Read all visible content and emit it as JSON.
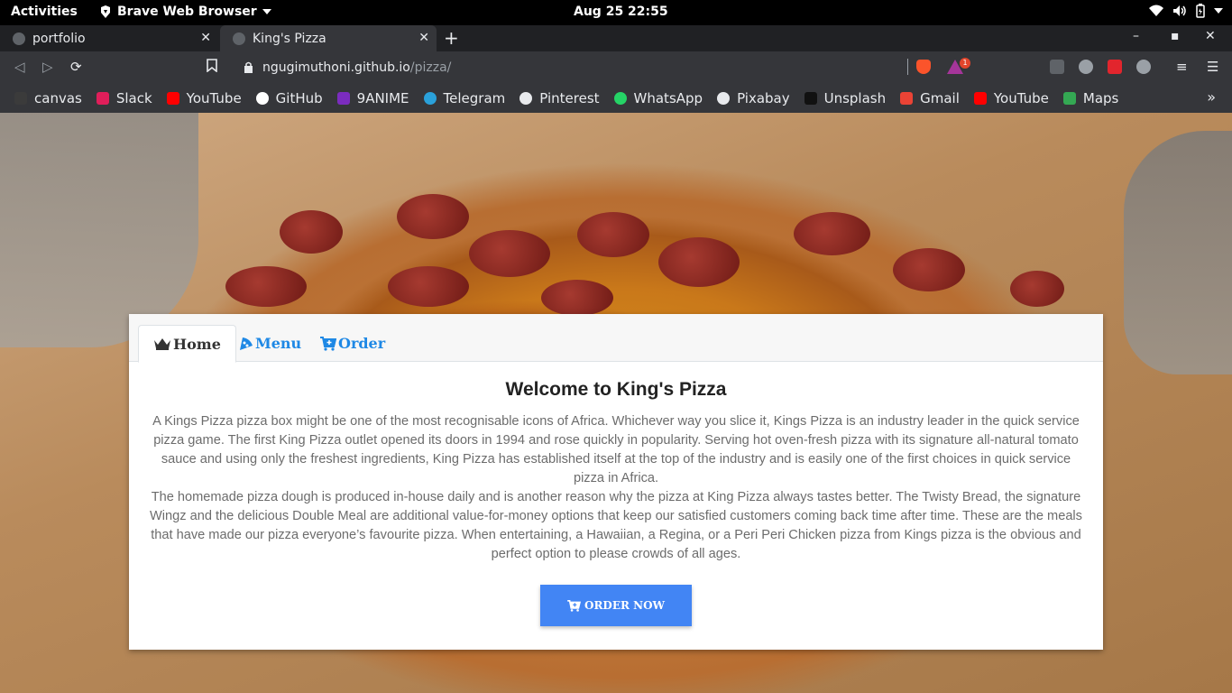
{
  "system": {
    "activities": "Activities",
    "app_name": "Brave Web Browser",
    "clock": "Aug 25  22:55"
  },
  "browser": {
    "tabs": [
      {
        "title": "portfolio",
        "active": false
      },
      {
        "title": "King's Pizza",
        "active": true
      }
    ],
    "url_host": "ngugimuthoni.github.io",
    "url_path": "/pizza/",
    "rewards_badge": "1",
    "bookmarks": [
      {
        "label": "canvas",
        "icon": "canvas-icon",
        "color": "#3b3b3b"
      },
      {
        "label": "Slack",
        "icon": "slack-icon",
        "color": "#e01e5a"
      },
      {
        "label": "YouTube",
        "icon": "youtube-icon",
        "color": "#ff0000"
      },
      {
        "label": "GitHub",
        "icon": "github-icon",
        "color": "#ffffff"
      },
      {
        "label": "9ANIME",
        "icon": "play-icon",
        "color": "#7b2cbf"
      },
      {
        "label": "Telegram",
        "icon": "telegram-icon",
        "color": "#2aa1da"
      },
      {
        "label": "Pinterest",
        "icon": "globe-icon",
        "color": "#e8eaed"
      },
      {
        "label": "WhatsApp",
        "icon": "whatsapp-icon",
        "color": "#25d366"
      },
      {
        "label": "Pixabay",
        "icon": "globe-icon",
        "color": "#e8eaed"
      },
      {
        "label": "Unsplash",
        "icon": "unsplash-icon",
        "color": "#111111"
      },
      {
        "label": "Gmail",
        "icon": "gmail-icon",
        "color": "#ea4335"
      },
      {
        "label": "YouTube",
        "icon": "youtube-icon",
        "color": "#ff0000"
      },
      {
        "label": "Maps",
        "icon": "maps-icon",
        "color": "#34a853"
      }
    ]
  },
  "site": {
    "tabs": {
      "home": "Home",
      "menu": "Menu",
      "order": "Order"
    },
    "heading": "Welcome to King's Pizza",
    "paragraph1": "A Kings Pizza pizza box might be one of the most recognisable icons of Africa. Whichever way you slice it, Kings Pizza is an industry leader in the quick service pizza game. The first King Pizza outlet opened its doors in 1994 and rose quickly in popularity. Serving hot oven-fresh pizza with its signature all-natural tomato sauce and using only the freshest ingredients, King Pizza has established itself at the top of the industry and is easily one of the first choices in quick service pizza in Africa.",
    "paragraph2": "The homemade pizza dough is produced in-house daily and is another reason why the pizza at King Pizza always tastes better. The Twisty Bread, the signature Wingz and the delicious Double Meal are additional value-for-money options that keep our satisfied customers coming back time after time. These are the meals that have made our pizza everyone’s favourite pizza. When entertaining, a Hawaiian, a Regina, or a Peri Peri Chicken pizza from Kings pizza is the obvious and perfect option to please crowds of all ages.",
    "order_button": "ORDER NOW",
    "accent_color": "#4285f4",
    "link_color": "#1e88e5"
  }
}
